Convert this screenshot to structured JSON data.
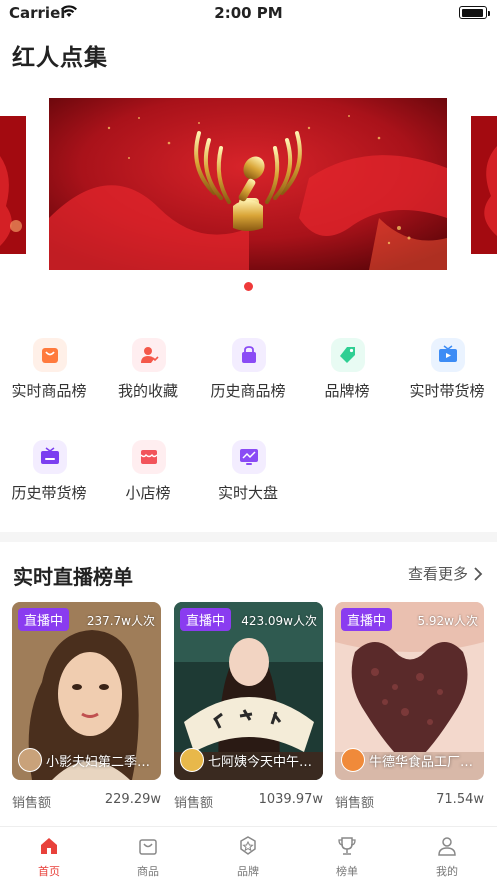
{
  "status_bar": {
    "carrier": "Carrier",
    "time": "2:00 PM"
  },
  "app_title": "红人点集",
  "colors": {
    "accent": "#e8413b",
    "live_badge": "#8a3cf0"
  },
  "categories": [
    {
      "label": "实时商品榜",
      "icon": "shopping-bag-icon"
    },
    {
      "label": "我的收藏",
      "icon": "favorite-user-icon"
    },
    {
      "label": "历史商品榜",
      "icon": "purple-bag-icon"
    },
    {
      "label": "品牌榜",
      "icon": "tag-icon"
    },
    {
      "label": "实时带货榜",
      "icon": "tv-play-icon"
    },
    {
      "label": "历史带货榜",
      "icon": "tv-icon"
    },
    {
      "label": "小店榜",
      "icon": "store-icon"
    },
    {
      "label": "实时大盘",
      "icon": "monitor-chart-icon"
    }
  ],
  "live_section": {
    "title": "实时直播榜单",
    "more": "查看更多"
  },
  "live_cards": [
    {
      "badge": "直播中",
      "viewers": "237.7w人次",
      "name": "小影夫妇第二季…",
      "sales_label": "销售额",
      "sales": "229.29w"
    },
    {
      "badge": "直播中",
      "viewers": "423.09w人次",
      "name": "七阿姨今天中午…",
      "sales_label": "销售额",
      "sales": "1039.97w"
    },
    {
      "badge": "直播中",
      "viewers": "5.92w人次",
      "name": "牛德华食品工厂…",
      "sales_label": "销售额",
      "sales": "71.54w"
    }
  ],
  "tabs": [
    {
      "label": "首页",
      "icon": "home-icon",
      "active": true
    },
    {
      "label": "商品",
      "icon": "bag-icon",
      "active": false
    },
    {
      "label": "品牌",
      "icon": "badge-icon",
      "active": false
    },
    {
      "label": "榜单",
      "icon": "trophy-icon",
      "active": false
    },
    {
      "label": "我的",
      "icon": "user-icon",
      "active": false
    }
  ]
}
